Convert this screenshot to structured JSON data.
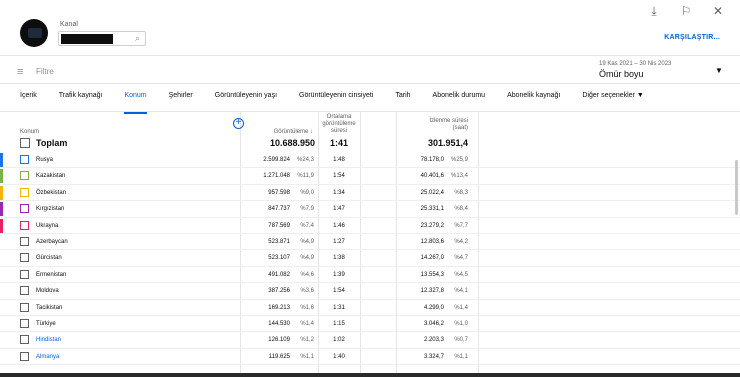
{
  "window": {
    "icons": [
      "download-icon",
      "feedback-icon",
      "close-icon"
    ],
    "glyphs": [
      "⤓",
      "⚐",
      "✕"
    ]
  },
  "header": {
    "channel_label": "Kanal",
    "search_glyph": "⌕",
    "compare_label": "KARŞILAŞTIR..."
  },
  "filter": {
    "label": "Filtre",
    "glyph": "≡"
  },
  "date": {
    "range": "19 Kas 2021 – 30 Nis 2023",
    "value": "Ömür boyu",
    "arrow": "▼"
  },
  "tabs": [
    "İçerik",
    "Trafik kaynağı",
    "Konum",
    "Şehirler",
    "Görüntüleyenin yaşı",
    "Görüntüleyenin cinsiyeti",
    "Tarih",
    "Abonelik durumu",
    "Abonelik kaynağı",
    "Diğer seçenekler ▼"
  ],
  "active_tab": 2,
  "table": {
    "add_glyph": "+",
    "headers": {
      "konum": "Konum",
      "views": "Görüntüleme ↓",
      "avg_lines": [
        "Ortalama",
        "görüntüleme",
        "süresi"
      ],
      "watch_lines": [
        "İzlenme süresi",
        "(saat)"
      ]
    },
    "total": {
      "label": "Toplam",
      "views": "10.688.950",
      "avg": "1:41",
      "watch": "301.951,4"
    },
    "rows": [
      {
        "name": "Rusya",
        "views": "2.599.824",
        "views_pct": "%24,3",
        "avg": "1:48",
        "watch": "78.178,0",
        "watch_pct": "%25,9",
        "color": "#1a73e8",
        "checked": true
      },
      {
        "name": "Kazakistan",
        "views": "1.271.048",
        "views_pct": "%11,9",
        "avg": "1:54",
        "watch": "40.401,6",
        "watch_pct": "%13,4",
        "color": "#7cb342",
        "checked": true
      },
      {
        "name": "Özbekistan",
        "views": "957.598",
        "views_pct": "%9,0",
        "avg": "1:34",
        "watch": "25.022,4",
        "watch_pct": "%8,3",
        "color": "#f4b400",
        "checked": true
      },
      {
        "name": "Kırgızistan",
        "views": "847.737",
        "views_pct": "%7,9",
        "avg": "1:47",
        "watch": "25.331,1",
        "watch_pct": "%8,4",
        "color": "#9c27b0",
        "checked": true
      },
      {
        "name": "Ukrayna",
        "views": "787.569",
        "views_pct": "%7,4",
        "avg": "1:46",
        "watch": "23.279,2",
        "watch_pct": "%7,7",
        "color": "#e91e63",
        "checked": true
      },
      {
        "name": "Azerbaycan",
        "views": "523.871",
        "views_pct": "%4,9",
        "avg": "1:27",
        "watch": "12.803,6",
        "watch_pct": "%4,2",
        "color": "",
        "checked": false
      },
      {
        "name": "Gürcistan",
        "views": "523.107",
        "views_pct": "%4,9",
        "avg": "1:38",
        "watch": "14.267,0",
        "watch_pct": "%4,7",
        "color": "",
        "checked": false
      },
      {
        "name": "Ermenistan",
        "views": "491.082",
        "views_pct": "%4,6",
        "avg": "1:39",
        "watch": "13.554,3",
        "watch_pct": "%4,5",
        "color": "",
        "checked": false
      },
      {
        "name": "Moldova",
        "views": "387.256",
        "views_pct": "%3,6",
        "avg": "1:54",
        "watch": "12.327,8",
        "watch_pct": "%4,1",
        "color": "",
        "checked": false
      },
      {
        "name": "Tacikistan",
        "views": "169.213",
        "views_pct": "%1,6",
        "avg": "1:31",
        "watch": "4.299,0",
        "watch_pct": "%1,4",
        "color": "",
        "checked": false
      },
      {
        "name": "Türkiye",
        "views": "144.530",
        "views_pct": "%1,4",
        "avg": "1:15",
        "watch": "3.046,2",
        "watch_pct": "%1,0",
        "color": "",
        "checked": false
      },
      {
        "name": "Hindistan",
        "views": "126.109",
        "views_pct": "%1,2",
        "avg": "1:02",
        "watch": "2.203,3",
        "watch_pct": "%0,7",
        "color": "",
        "checked": false,
        "link": true
      },
      {
        "name": "Almanya",
        "views": "119.625",
        "views_pct": "%1,1",
        "avg": "1:40",
        "watch": "3.324,7",
        "watch_pct": "%1,1",
        "color": "",
        "checked": false,
        "link": true
      }
    ]
  }
}
